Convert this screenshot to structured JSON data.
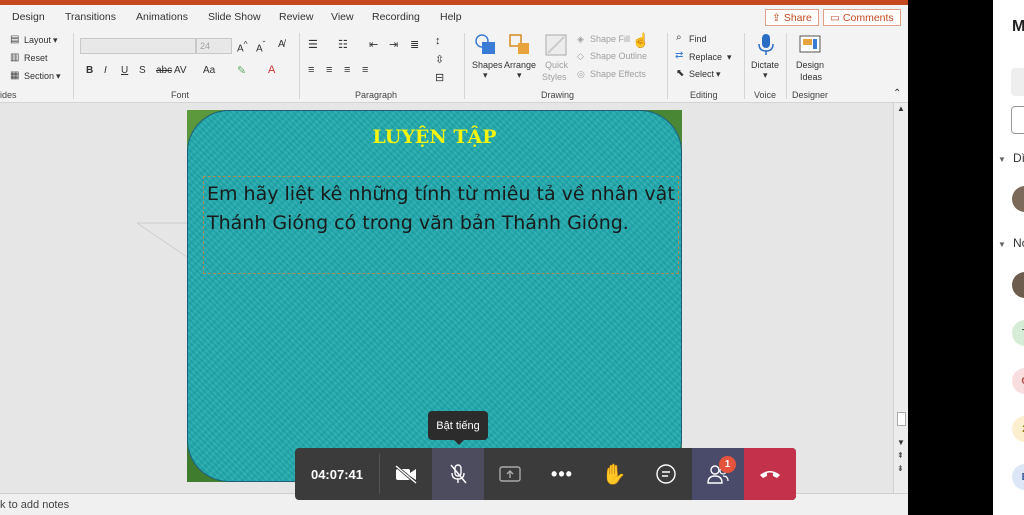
{
  "menu": [
    "Design",
    "Transitions",
    "Animations",
    "Slide Show",
    "Review",
    "View",
    "Recording",
    "Help"
  ],
  "share_label": "Share",
  "comments_label": "Comments",
  "ribbon": {
    "slides": {
      "layout": "Layout",
      "reset": "Reset",
      "section": "Section",
      "group": "ides"
    },
    "font": {
      "size": "24",
      "group": "Font"
    },
    "paragraph": {
      "group": "Paragraph"
    },
    "drawing": {
      "shapes": "Shapes",
      "arrange": "Arrange",
      "quick": "Quick",
      "styles": "Styles",
      "fill": "Shape Fill",
      "outline": "Shape Outline",
      "effects": "Shape Effects",
      "group": "Drawing"
    },
    "editing": {
      "find": "Find",
      "replace": "Replace",
      "select": "Select",
      "group": "Editing"
    },
    "voice": {
      "dictate": "Dictate",
      "group": "Voice"
    },
    "designer": {
      "design": "Design",
      "ideas": "Ideas",
      "group": "Designer"
    }
  },
  "slide": {
    "title": "LUYỆN TẬP",
    "body": "Em hãy liệt kê những tính từ miêu tả về nhân vật Thánh Gióng có trong văn bản Thánh Gióng."
  },
  "notes_hint": "k to add notes",
  "call": {
    "timer": "04:07:41",
    "tooltip": "Bật tiếng",
    "participants_badge": "1"
  },
  "panel": {
    "header_letter": "M",
    "section1": "Dì",
    "section2": "Nc",
    "avatar_letters": [
      "T",
      "C",
      "2",
      "E"
    ]
  },
  "colors": {
    "title": "#f4f40e",
    "slide_bg": "#1fa9ad",
    "hangup": "#c4314b",
    "accent": "#c5481f"
  }
}
